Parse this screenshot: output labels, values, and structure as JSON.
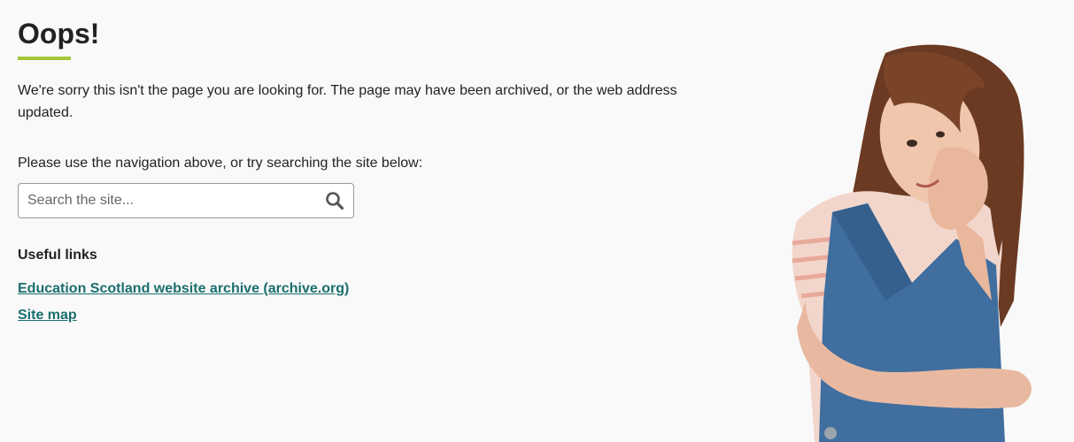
{
  "main": {
    "title": "Oops!",
    "intro": "We're sorry this isn't the page you are looking for. The page may have been archived, or the web address updated.",
    "nav_hint": "Please use the navigation above, or try searching the site below:"
  },
  "search": {
    "placeholder": "Search the site...",
    "value": ""
  },
  "useful_links": {
    "heading": "Useful links",
    "items": [
      {
        "label": "Education Scotland website archive (archive.org)"
      },
      {
        "label": "Site map"
      }
    ]
  },
  "colors": {
    "accent_bar": "#a4c639",
    "link": "#1a6e6e",
    "background": "#f9f9f9"
  },
  "icons": {
    "search": "search-icon"
  }
}
